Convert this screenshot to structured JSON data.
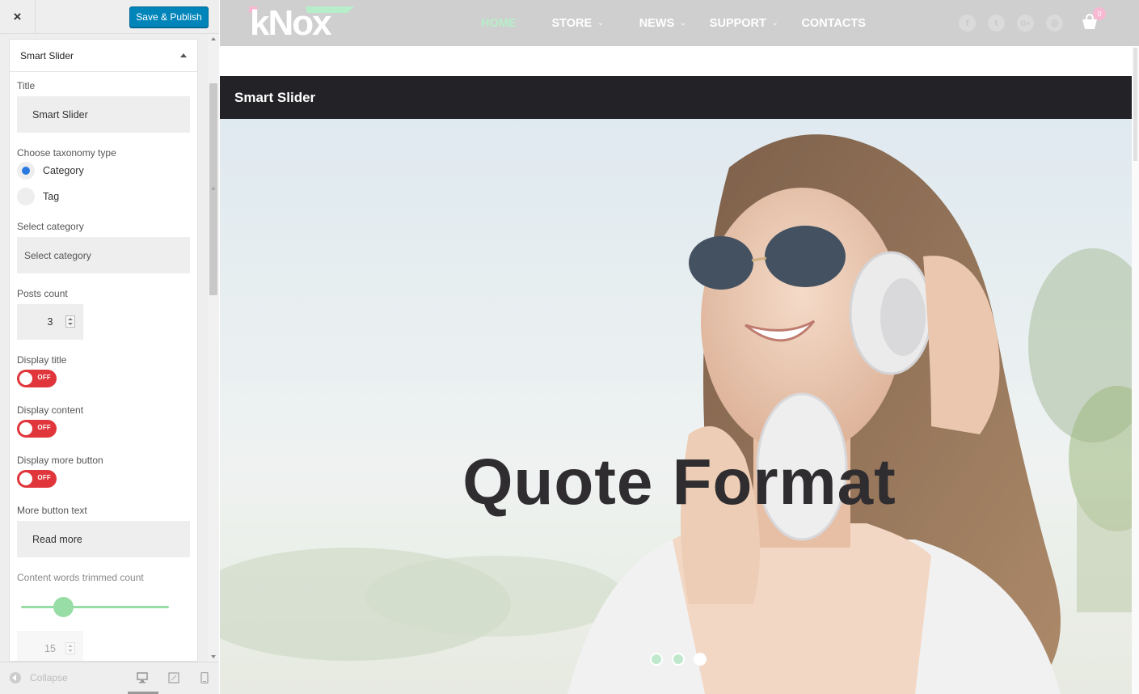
{
  "panel": {
    "close_label": "×",
    "save_label": "Save & Publish",
    "section_title": "Smart Slider",
    "title": {
      "label": "Title",
      "value": "Smart Slider"
    },
    "taxonomy": {
      "label": "Choose taxonomy type",
      "options": [
        {
          "label": "Category",
          "selected": true
        },
        {
          "label": "Tag",
          "selected": false
        }
      ]
    },
    "category": {
      "label": "Select category",
      "placeholder": "Select category"
    },
    "posts_count": {
      "label": "Posts count",
      "value": "3"
    },
    "display_title": {
      "label": "Display title",
      "state": "OFF"
    },
    "display_content": {
      "label": "Display content",
      "state": "OFF"
    },
    "display_more": {
      "label": "Display more button",
      "state": "OFF"
    },
    "more_text": {
      "label": "More button text",
      "value": "Read more"
    },
    "trim_count": {
      "label": "Content words trimmed count",
      "value": "15"
    },
    "footer": {
      "collapse_label": "Collapse"
    }
  },
  "site": {
    "logo": "kNox",
    "nav": [
      {
        "label": "HOME",
        "active": true,
        "dropdown": false
      },
      {
        "label": "STORE",
        "active": false,
        "dropdown": true
      },
      {
        "label": "NEWS",
        "active": false,
        "dropdown": true
      },
      {
        "label": "SUPPORT",
        "active": false,
        "dropdown": true
      },
      {
        "label": "CONTACTS",
        "active": false,
        "dropdown": false
      }
    ],
    "socials": [
      "facebook-icon",
      "twitter-icon",
      "google-plus-icon",
      "instagram-icon"
    ],
    "social_glyphs": [
      "f",
      "t",
      "G+",
      "◎"
    ],
    "cart_count": "0",
    "widget_title": "Smart Slider",
    "slide_title": "Quote Format",
    "slide_dots": 3,
    "active_slide": 3
  },
  "colors": {
    "publish_button": "#0085ba",
    "toggle_off": "#e0353b",
    "accent_green": "#98dca6",
    "nav_active": "#b6eec9",
    "header_bg": "#cfcfcf",
    "titlebar_bg": "#232226"
  }
}
